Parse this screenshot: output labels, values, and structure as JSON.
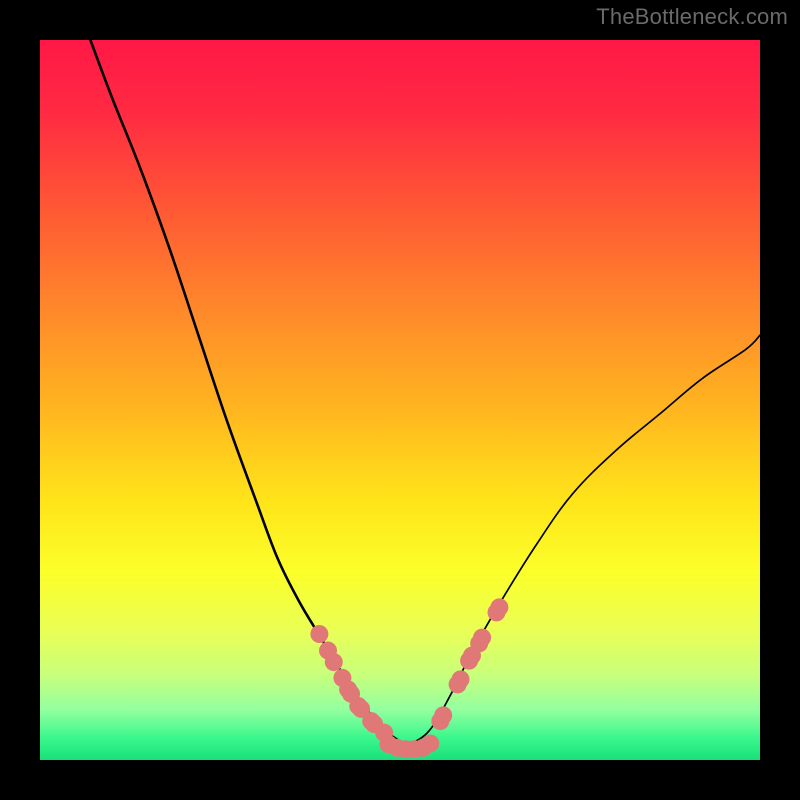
{
  "watermark": "TheBottleneck.com",
  "chart_data": {
    "type": "line",
    "title": "",
    "xlabel": "",
    "ylabel": "",
    "xlim": [
      0,
      100
    ],
    "ylim": [
      0,
      100
    ],
    "curve_left": {
      "name": "left-branch",
      "x": [
        7,
        10,
        14,
        18,
        22,
        26,
        30,
        33,
        36,
        39,
        42,
        45,
        48,
        51
      ],
      "y": [
        100,
        92,
        82,
        71,
        59,
        47,
        36,
        28,
        22,
        17,
        12,
        7.5,
        4,
        2
      ]
    },
    "curve_right": {
      "name": "right-branch",
      "x": [
        51,
        54,
        57,
        60,
        64,
        69,
        74,
        80,
        86,
        92,
        98,
        100
      ],
      "y": [
        2,
        4,
        9,
        15,
        22,
        30,
        37,
        43,
        48,
        53,
        57,
        59
      ]
    },
    "dots_left": {
      "name": "left-dots",
      "x": [
        38.8,
        40.0,
        40.8,
        42.0,
        42.8,
        43.2,
        44.2,
        44.6,
        46.0,
        46.4,
        47.8
      ],
      "y": [
        17.5,
        15.2,
        13.6,
        11.4,
        9.8,
        9.2,
        7.5,
        7.1,
        5.4,
        5.0,
        3.8
      ]
    },
    "dots_bottom": {
      "name": "bottom-dots",
      "x": [
        48.4,
        49.6,
        50.8,
        52.0,
        53.2,
        54.2
      ],
      "y": [
        2.2,
        1.7,
        1.5,
        1.5,
        1.7,
        2.3
      ]
    },
    "dots_right": {
      "name": "right-dots",
      "x": [
        55.6,
        56.0,
        58.0,
        58.4,
        59.6,
        60.0,
        61.0,
        61.4,
        63.4,
        63.8
      ],
      "y": [
        5.4,
        6.2,
        10.5,
        11.2,
        13.8,
        14.5,
        16.2,
        17.0,
        20.5,
        21.2
      ]
    },
    "style": {
      "dot_color": "#e17878",
      "dot_radius_px": 9,
      "line_color": "#000000",
      "line_width_left": 2.6,
      "line_width_right": 1.7
    }
  }
}
